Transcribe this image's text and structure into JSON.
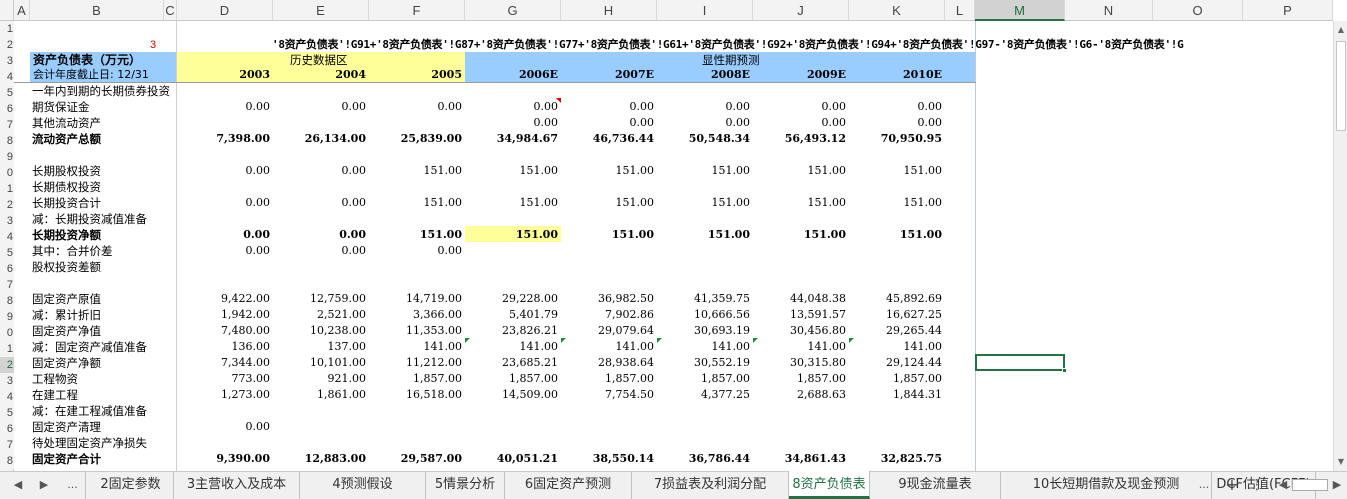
{
  "columns": [
    "A",
    "B",
    "C",
    "D",
    "E",
    "F",
    "G",
    "H",
    "I",
    "J",
    "K",
    "L",
    "M",
    "N",
    "O",
    "P"
  ],
  "rows": [
    "1",
    "2",
    "3",
    "4",
    "5",
    "6",
    "7",
    "8",
    "9",
    "0",
    "1",
    "2",
    "3",
    "4",
    "5",
    "6",
    "7",
    "8",
    "9",
    "0",
    "1",
    "2",
    "3",
    "4",
    "5",
    "6",
    "7",
    "8"
  ],
  "header": {
    "marker": "3",
    "title": "资产负债表（万元）",
    "fiscal": "会计年度截止日: 12/31",
    "historical": "历史数据区",
    "forecast": "显性期预测",
    "formula": "'8资产负债表'!G91+'8资产负债表'!G87+'8资产负债表'!G77+'8资产负债表'!G61+'8资产负债表'!G92+'8资产负债表'!G94+'8资产负债表'!G97-'8资产负债表'!G6-'8资产负债表'!G",
    "years": [
      "2003",
      "2004",
      "2005",
      "2006E",
      "2007E",
      "2008E",
      "2009E",
      "2010E"
    ]
  },
  "table": [
    {
      "label": "一年内到期的长期债券投资",
      "values": [
        "",
        "",
        "",
        "",
        "",
        "",
        "",
        ""
      ],
      "bold": false
    },
    {
      "label": "期货保证金",
      "values": [
        "0.00",
        "0.00",
        "0.00",
        "0.00",
        "0.00",
        "0.00",
        "0.00",
        "0.00"
      ],
      "bold": false
    },
    {
      "label": "其他流动资产",
      "values": [
        "",
        "",
        "",
        "0.00",
        "0.00",
        "0.00",
        "0.00",
        "0.00"
      ],
      "bold": false
    },
    {
      "label": "流动资产总额",
      "values": [
        "7,398.00",
        "26,134.00",
        "25,839.00",
        "34,984.67",
        "46,736.44",
        "50,548.34",
        "56,493.12",
        "70,950.95"
      ],
      "bold": true
    },
    {
      "label": "",
      "values": [
        "",
        "",
        "",
        "",
        "",
        "",
        "",
        ""
      ],
      "bold": false
    },
    {
      "label": "长期股权投资",
      "values": [
        "0.00",
        "0.00",
        "151.00",
        "151.00",
        "151.00",
        "151.00",
        "151.00",
        "151.00"
      ],
      "bold": false
    },
    {
      "label": "长期债权投资",
      "values": [
        "",
        "",
        "",
        "",
        "",
        "",
        "",
        ""
      ],
      "bold": false
    },
    {
      "label": "长期投资合计",
      "values": [
        "0.00",
        "0.00",
        "151.00",
        "151.00",
        "151.00",
        "151.00",
        "151.00",
        "151.00"
      ],
      "bold": false
    },
    {
      "label": "减：长期投资减值准备",
      "values": [
        "",
        "",
        "",
        "",
        "",
        "",
        "",
        ""
      ],
      "bold": false
    },
    {
      "label": "长期投资净额",
      "values": [
        "0.00",
        "0.00",
        "151.00",
        "151.00",
        "151.00",
        "151.00",
        "151.00",
        "151.00"
      ],
      "bold": true
    },
    {
      "label": "其中：合并价差",
      "values": [
        "0.00",
        "0.00",
        "0.00",
        "",
        "",
        "",
        "",
        ""
      ],
      "bold": false
    },
    {
      "label": "股权投资差额",
      "values": [
        "",
        "",
        "",
        "",
        "",
        "",
        "",
        ""
      ],
      "bold": false
    },
    {
      "label": "",
      "values": [
        "",
        "",
        "",
        "",
        "",
        "",
        "",
        ""
      ],
      "bold": false
    },
    {
      "label": "固定资产原值",
      "values": [
        "9,422.00",
        "12,759.00",
        "14,719.00",
        "29,228.00",
        "36,982.50",
        "41,359.75",
        "44,048.38",
        "45,892.69"
      ],
      "bold": false
    },
    {
      "label": "减：累计折旧",
      "values": [
        "1,942.00",
        "2,521.00",
        "3,366.00",
        "5,401.79",
        "7,902.86",
        "10,666.56",
        "13,591.57",
        "16,627.25"
      ],
      "bold": false
    },
    {
      "label": "固定资产净值",
      "values": [
        "7,480.00",
        "10,238.00",
        "11,353.00",
        "23,826.21",
        "29,079.64",
        "30,693.19",
        "30,456.80",
        "29,265.44"
      ],
      "bold": false
    },
    {
      "label": "减：固定资产减值准备",
      "values": [
        "136.00",
        "137.00",
        "141.00",
        "141.00",
        "141.00",
        "141.00",
        "141.00",
        "141.00"
      ],
      "bold": false
    },
    {
      "label": "固定资产净额",
      "values": [
        "7,344.00",
        "10,101.00",
        "11,212.00",
        "23,685.21",
        "28,938.64",
        "30,552.19",
        "30,315.80",
        "29,124.44"
      ],
      "bold": false
    },
    {
      "label": "工程物资",
      "values": [
        "773.00",
        "921.00",
        "1,857.00",
        "1,857.00",
        "1,857.00",
        "1,857.00",
        "1,857.00",
        "1,857.00"
      ],
      "bold": false
    },
    {
      "label": "在建工程",
      "values": [
        "1,273.00",
        "1,861.00",
        "16,518.00",
        "14,509.00",
        "7,754.50",
        "4,377.25",
        "2,688.63",
        "1,844.31"
      ],
      "bold": false
    },
    {
      "label": "减：在建工程减值准备",
      "values": [
        "",
        "",
        "",
        "",
        "",
        "",
        "",
        ""
      ],
      "bold": false
    },
    {
      "label": "固定资产清理",
      "values": [
        "0.00",
        "",
        "",
        "",
        "",
        "",
        "",
        ""
      ],
      "bold": false
    },
    {
      "label": "待处理固定资产净损失",
      "values": [
        "",
        "",
        "",
        "",
        "",
        "",
        "",
        ""
      ],
      "bold": false
    },
    {
      "label": "固定资产合计",
      "values": [
        "9,390.00",
        "12,883.00",
        "29,587.00",
        "40,051.21",
        "38,550.14",
        "36,786.44",
        "34,861.43",
        "32,825.75"
      ],
      "bold": true
    }
  ],
  "tabs": [
    "2固定参数",
    "3主营收入及成本",
    "4预测假设",
    "5情景分析",
    "6固定资产预测",
    "7损益表及利润分配",
    "8资产负债表",
    "9现金流量表",
    "10长短期借款及现金预测",
    "DCF估值(FCFF)"
  ],
  "active_tab": "8资产负债表",
  "nav": {
    "prev": "◀",
    "next": "▶",
    "more": "...",
    "add": "+",
    "options": "⋮"
  },
  "colors": {
    "yellow": "#ffff99",
    "blue": "#99ccff",
    "accent": "#217346"
  }
}
